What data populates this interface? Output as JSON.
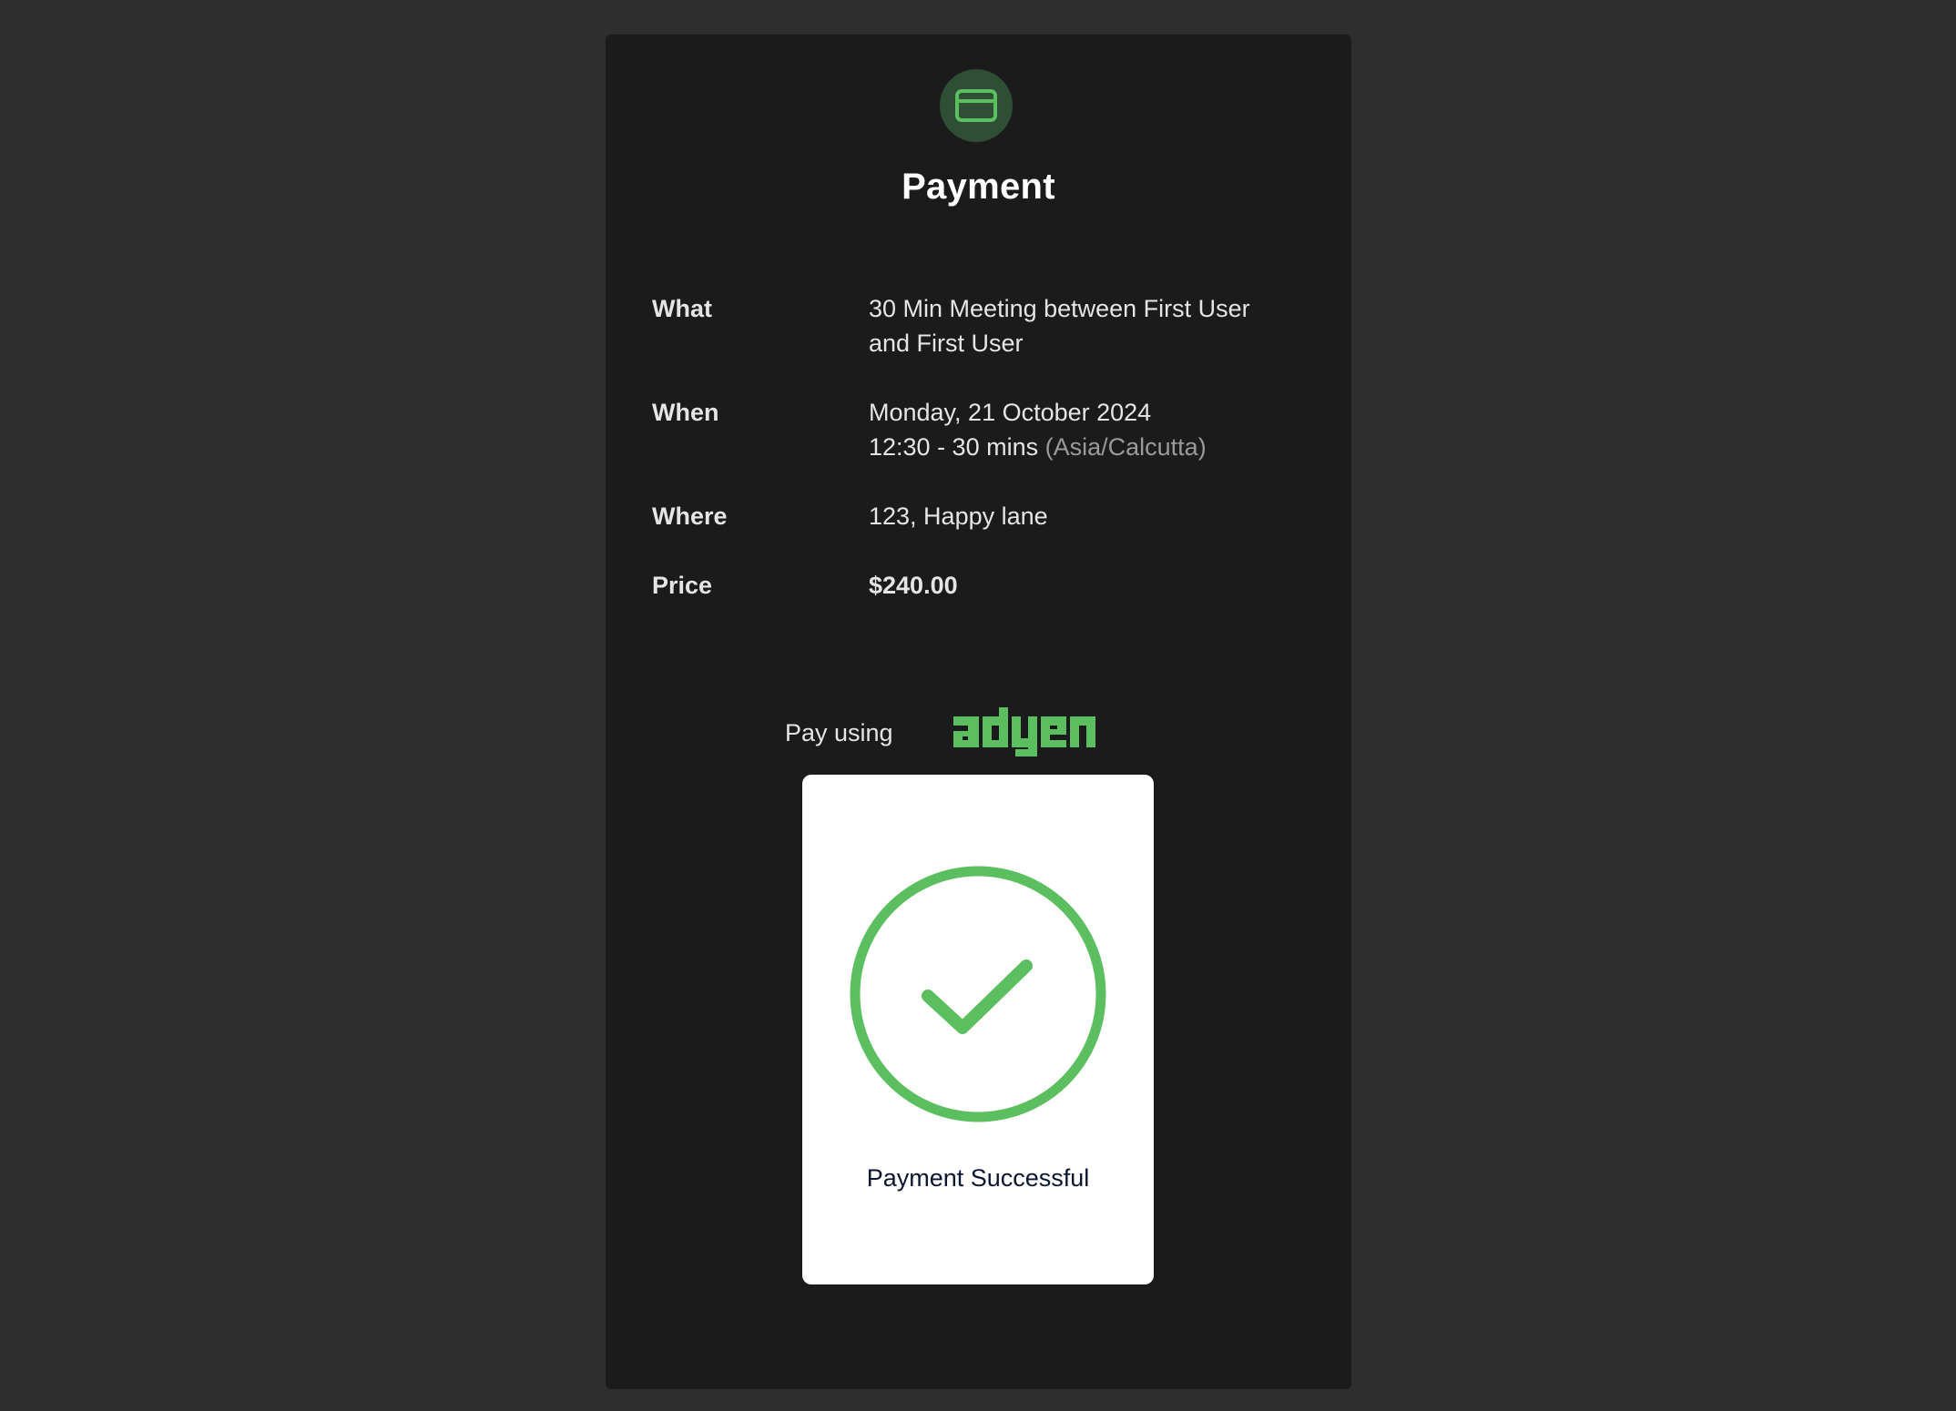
{
  "header": {
    "icon": "credit-card-icon",
    "title": "Payment"
  },
  "details": {
    "what": {
      "label": "What",
      "value_line1": "30 Min Meeting between First User",
      "value_line2": "and First User"
    },
    "when": {
      "label": "When",
      "date": "Monday, 21 October 2024",
      "time": "12:30 - 30 mins",
      "timezone": "(Asia/Calcutta)"
    },
    "where": {
      "label": "Where",
      "value": "123, Happy lane"
    },
    "price": {
      "label": "Price",
      "value": "$240.00"
    }
  },
  "payment": {
    "pay_using_label": "Pay using",
    "provider": "adyen",
    "status_text": "Payment Successful",
    "status_icon": "check-circle-icon"
  },
  "colors": {
    "page_background": "#2e2e2e",
    "card_background": "#1b1b1b",
    "accent_green": "#5cbf5f",
    "icon_circle_background": "#2f4f34"
  }
}
